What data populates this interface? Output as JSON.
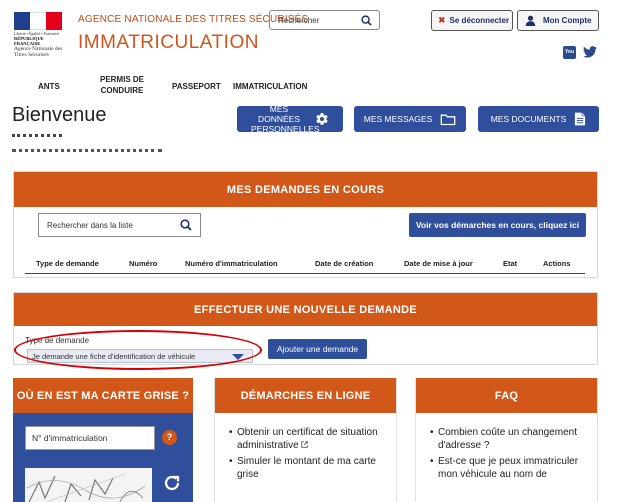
{
  "header": {
    "logo_motto": "Liberté • Égalité • Fraternité",
    "logo_republic": "RÉPUBLIQUE FRANÇAISE",
    "logo_agency": "Agence Nationale des Titres Sécurisés",
    "agency_name": "AGENCE NATIONALE DES TITRES SÉCURISÉS",
    "app_title": "IMMATRICULATION",
    "search_placeholder": "Rechercher",
    "logout_label": "Se déconnecter",
    "account_label": "Mon Compte",
    "youtube_label": "You Tube"
  },
  "nav": {
    "items": [
      {
        "label": "ANTS"
      },
      {
        "label": "PERMIS DE CONDUIRE"
      },
      {
        "label": "PASSEPORT"
      },
      {
        "label": "IMMATRICULATION"
      }
    ]
  },
  "welcome": {
    "title": "Bienvenue"
  },
  "actions": {
    "personal_data": "MES DONNÉES PERSONNELLES",
    "messages": "MES MESSAGES",
    "documents": "MES DOCUMENTS"
  },
  "current_requests": {
    "title": "MES DEMANDES EN COURS",
    "search_placeholder": "Rechercher dans la liste",
    "view_all_button": "Voir vos démarches en cours, cliquez ici",
    "columns": [
      "Type de demande",
      "Numéro",
      "Numéro d'immatriculation",
      "Date de création",
      "Date de mise à jour",
      "Etat",
      "Actions"
    ]
  },
  "new_request": {
    "title": "EFFECTUER UNE NOUVELLE DEMANDE",
    "type_label": "Type de demande",
    "selected_option": "Je demande une fiche d'identification de véhicule",
    "add_button": "Ajouter une demande"
  },
  "cards": {
    "status": {
      "title": "OÙ EN EST MA CARTE GRISE ?",
      "input_placeholder": "N° d'immatriculation",
      "help": "?"
    },
    "online": {
      "title": "DÉMARCHES EN LIGNE",
      "items": [
        "Obtenir un certificat de situation administrative",
        "Simuler le montant de ma carte grise"
      ]
    },
    "faq": {
      "title": "FAQ",
      "items": [
        "Combien coûte un changement d'adresse ?",
        "Est-ce que je peux immatriculer mon véhicule au nom de"
      ]
    }
  },
  "colors": {
    "accent_orange": "#d2581a",
    "brand_blue": "#2f4f9c",
    "highlight_red": "#d40000"
  }
}
